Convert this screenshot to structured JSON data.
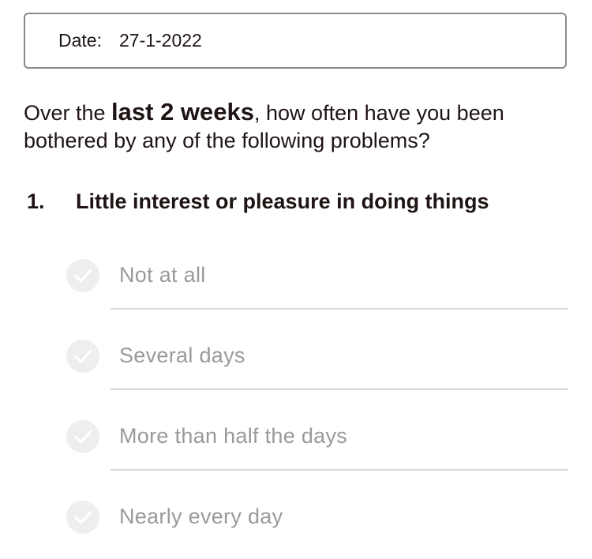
{
  "date": {
    "label": "Date:",
    "value": "27-1-2022"
  },
  "intro": {
    "before": "Over the ",
    "emphasis": "last 2 weeks",
    "after": ", how often have you been bothered by any of the following problems?"
  },
  "question": {
    "number": "1.",
    "text": "Little interest or pleasure in doing things",
    "options": [
      {
        "label": "Not at all",
        "icon": "checkmark-icon"
      },
      {
        "label": "Several days",
        "icon": "checkmark-icon"
      },
      {
        "label": "More than half the days",
        "icon": "checkmark-icon"
      },
      {
        "label": "Nearly every day",
        "icon": "checkmark-icon"
      }
    ]
  },
  "colors": {
    "text": "#1f1414",
    "option_text": "#9a9a9a",
    "check_circle": "#eeeeee",
    "divider": "#d6d6d6",
    "date_border": "#8a8a8a"
  }
}
